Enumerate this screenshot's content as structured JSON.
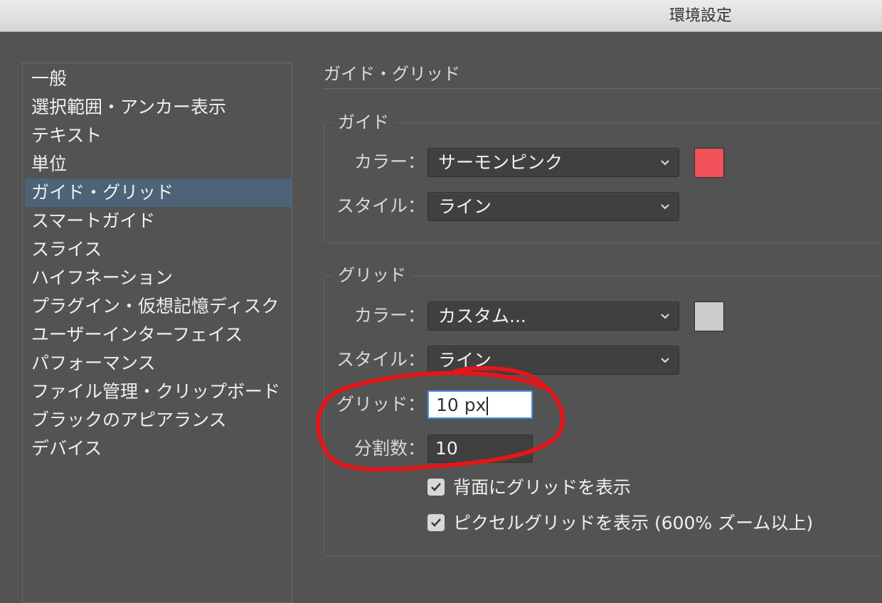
{
  "window": {
    "title": "環境設定"
  },
  "sidebar": {
    "items": [
      {
        "label": "一般"
      },
      {
        "label": "選択範囲・アンカー表示"
      },
      {
        "label": "テキスト"
      },
      {
        "label": "単位"
      },
      {
        "label": "ガイド・グリッド",
        "selected": true
      },
      {
        "label": "スマートガイド"
      },
      {
        "label": "スライス"
      },
      {
        "label": "ハイフネーション"
      },
      {
        "label": "プラグイン・仮想記憶ディスク"
      },
      {
        "label": "ユーザーインターフェイス"
      },
      {
        "label": "パフォーマンス"
      },
      {
        "label": "ファイル管理・クリップボード"
      },
      {
        "label": "ブラックのアピアランス"
      },
      {
        "label": "デバイス"
      }
    ]
  },
  "main": {
    "title": "ガイド・グリッド",
    "guide": {
      "group_label": "ガイド",
      "color_label": "カラー：",
      "color_value": "サーモンピンク",
      "color_swatch": "#f2525a",
      "style_label": "スタイル：",
      "style_value": "ライン"
    },
    "grid": {
      "group_label": "グリッド",
      "color_label": "カラー：",
      "color_value": "カスタム...",
      "color_swatch": "#cbcbcb",
      "style_label": "スタイル：",
      "style_value": "ライン",
      "gridline_label": "グリッド：",
      "gridline_value": "10 px",
      "subdivisions_label": "分割数：",
      "subdivisions_value": "10",
      "grids_in_back_label": "背面にグリッドを表示",
      "grids_in_back_checked": true,
      "pixel_grid_label": "ピクセルグリッドを表示 (600% ズーム以上)",
      "pixel_grid_checked": true
    }
  },
  "colors": {
    "background": "#535353",
    "selection": "#4d6377",
    "annotation_circle": "#e4161a"
  }
}
